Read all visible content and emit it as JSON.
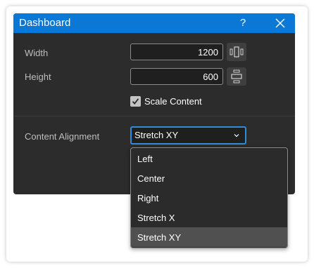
{
  "dialog": {
    "title": "Dashboard",
    "help_label": "?",
    "close_icon": "close-icon"
  },
  "size": {
    "width_label": "Width",
    "width_value": "1200",
    "width_icon": "stretch-horizontal-icon",
    "height_label": "Height",
    "height_value": "600",
    "height_icon": "stretch-vertical-icon"
  },
  "scale": {
    "checked": true,
    "label": "Scale Content"
  },
  "alignment": {
    "label": "Content Alignment",
    "selected": "Stretch XY",
    "options": [
      "Left",
      "Center",
      "Right",
      "Stretch X",
      "Stretch XY"
    ]
  },
  "colors": {
    "titlebar": "#0a78d4",
    "dialog_bg": "#2c2c2c",
    "select_focus_border": "#2d8ce0",
    "dropdown_selected_bg": "#505050"
  }
}
